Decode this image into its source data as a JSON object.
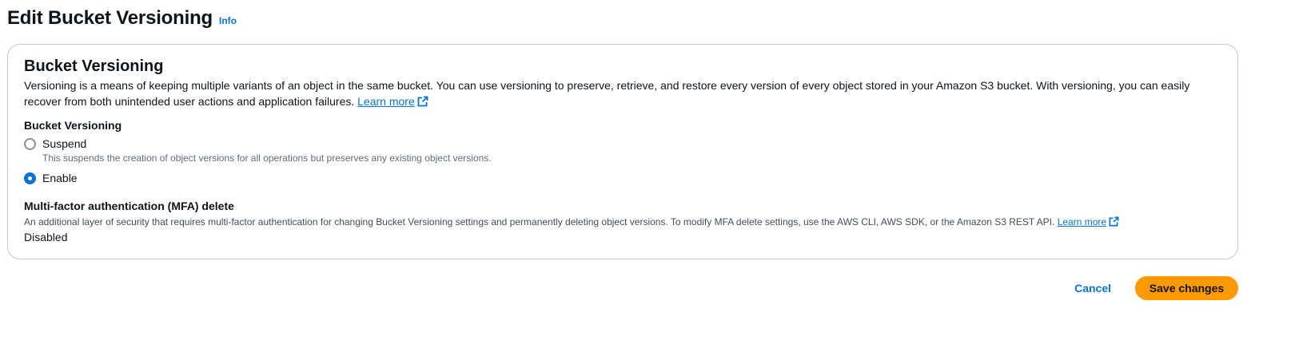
{
  "header": {
    "title": "Edit Bucket Versioning",
    "info_link": "Info"
  },
  "section": {
    "title": "Bucket Versioning",
    "description": "Versioning is a means of keeping multiple variants of an object in the same bucket. You can use versioning to preserve, retrieve, and restore every version of every object stored in your Amazon S3 bucket. With versioning, you can easily recover from both unintended user actions and application failures.",
    "learn_more": "Learn more"
  },
  "versioning": {
    "label": "Bucket Versioning",
    "options": [
      {
        "label": "Suspend",
        "description": "This suspends the creation of object versions for all operations but preserves any existing object versions.",
        "checked": false
      },
      {
        "label": "Enable",
        "description": "",
        "checked": true
      }
    ]
  },
  "mfa": {
    "label": "Multi-factor authentication (MFA) delete",
    "description": "An additional layer of security that requires multi-factor authentication for changing Bucket Versioning settings and permanently deleting object versions. To modify MFA delete settings, use the AWS CLI, AWS SDK, or the Amazon S3 REST API.",
    "learn_more": "Learn more",
    "value": "Disabled"
  },
  "actions": {
    "cancel_label": "Cancel",
    "save_label": "Save changes"
  },
  "colors": {
    "link": "#0972d3",
    "primary_button": "#ff9900",
    "text": "#0f141a",
    "border": "#c6c6cd"
  }
}
